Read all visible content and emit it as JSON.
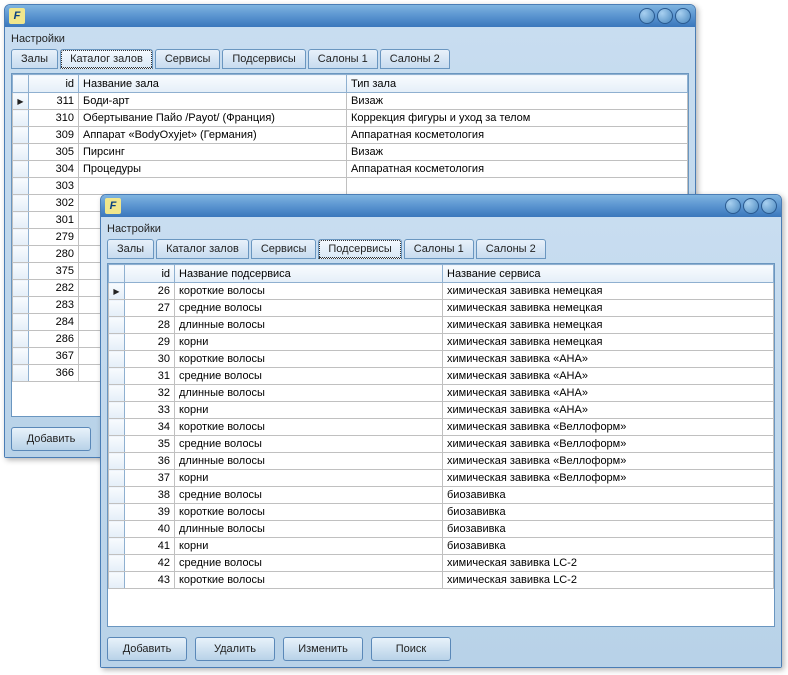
{
  "app_glyph": "F",
  "section_label": "Настройки",
  "tabs": {
    "zaly": "Залы",
    "katalog": "Каталог залов",
    "servisy": "Сервисы",
    "podservisy": "Подсервисы",
    "salony1": "Салоны 1",
    "salony2": "Салоны 2"
  },
  "buttons": {
    "add": "Добавить",
    "delete": "Удалить",
    "edit": "Изменить",
    "search": "Поиск"
  },
  "back": {
    "headers": {
      "id": "id",
      "name": "Название зала",
      "type": "Тип зала"
    },
    "rows": [
      {
        "id": 311,
        "name": "Боди-арт",
        "type": "Визаж"
      },
      {
        "id": 310,
        "name": "Обертывание Пайо /Payot/ (Франция)",
        "type": "Коррекция фигуры и уход за телом"
      },
      {
        "id": 309,
        "name": "Аппарат «BodyOxyjet» (Германия)",
        "type": "Аппаратная косметология"
      },
      {
        "id": 305,
        "name": "Пирсинг",
        "type": "Визаж"
      },
      {
        "id": 304,
        "name": "Процедуры",
        "type": "Аппаратная косметология"
      },
      {
        "id": 303,
        "name": "",
        "type": ""
      },
      {
        "id": 302,
        "name": "",
        "type": ""
      },
      {
        "id": 301,
        "name": "",
        "type": ""
      },
      {
        "id": 279,
        "name": "",
        "type": ""
      },
      {
        "id": 280,
        "name": "",
        "type": ""
      },
      {
        "id": 375,
        "name": "",
        "type": ""
      },
      {
        "id": 282,
        "name": "",
        "type": ""
      },
      {
        "id": 283,
        "name": "",
        "type": ""
      },
      {
        "id": 284,
        "name": "",
        "type": ""
      },
      {
        "id": 286,
        "name": "",
        "type": ""
      },
      {
        "id": 367,
        "name": "",
        "type": ""
      },
      {
        "id": 366,
        "name": "",
        "type": ""
      }
    ]
  },
  "front": {
    "headers": {
      "id": "id",
      "name": "Название подсервиса",
      "service": "Название сервиса"
    },
    "rows": [
      {
        "id": 26,
        "name": "короткие волосы",
        "service": "химическая завивка немецкая"
      },
      {
        "id": 27,
        "name": "средние волосы",
        "service": "химическая завивка немецкая"
      },
      {
        "id": 28,
        "name": "длинные волосы",
        "service": "химическая завивка немецкая"
      },
      {
        "id": 29,
        "name": "корни",
        "service": "химическая завивка немецкая"
      },
      {
        "id": 30,
        "name": "короткие волосы",
        "service": "химическая завивка «АНА»"
      },
      {
        "id": 31,
        "name": "средние волосы",
        "service": "химическая завивка «АНА»"
      },
      {
        "id": 32,
        "name": "длинные волосы",
        "service": "химическая завивка «АНА»"
      },
      {
        "id": 33,
        "name": "корни",
        "service": "химическая завивка «АНА»"
      },
      {
        "id": 34,
        "name": "короткие волосы",
        "service": "химическая завивка «Веллоформ»"
      },
      {
        "id": 35,
        "name": "средние волосы",
        "service": "химическая завивка «Веллоформ»"
      },
      {
        "id": 36,
        "name": "длинные волосы",
        "service": "химическая завивка «Веллоформ»"
      },
      {
        "id": 37,
        "name": "корни",
        "service": "химическая завивка «Веллоформ»"
      },
      {
        "id": 38,
        "name": "средние волосы",
        "service": "биозавивка"
      },
      {
        "id": 39,
        "name": "короткие волосы",
        "service": "биозавивка"
      },
      {
        "id": 40,
        "name": "длинные волосы",
        "service": "биозавивка"
      },
      {
        "id": 41,
        "name": "корни",
        "service": "биозавивка"
      },
      {
        "id": 42,
        "name": "средние волосы",
        "service": "химическая завивка LC-2"
      },
      {
        "id": 43,
        "name": "короткие волосы",
        "service": "химическая завивка LC-2"
      }
    ]
  }
}
